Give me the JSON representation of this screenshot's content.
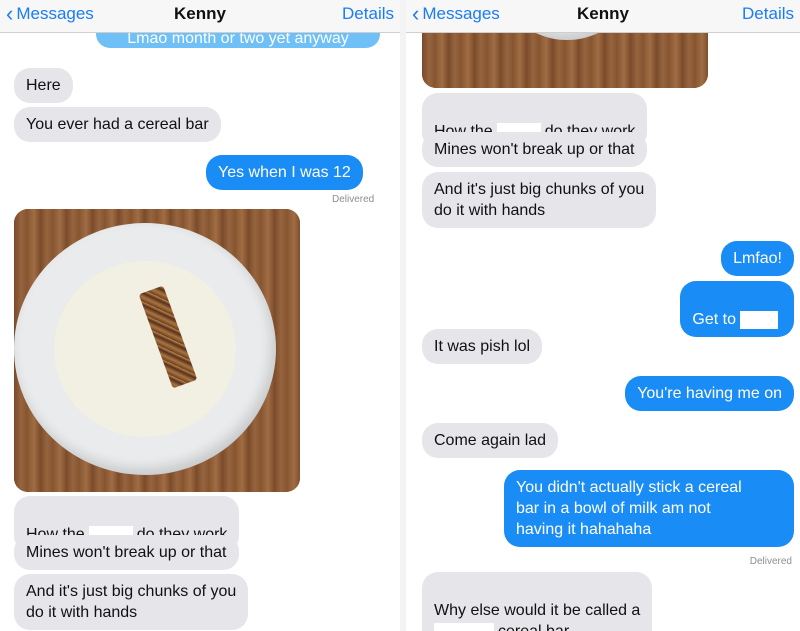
{
  "left_panel": {
    "nav": {
      "back_label": "Messages",
      "back_icon": "chevron-left-icon",
      "contact": "Kenny",
      "details_label": "Details"
    },
    "partial_top": "Lmao month or two yet anyway",
    "messages": {
      "m1": "Here",
      "m2": "You ever had a cereal bar",
      "m3": "Yes when I was 12",
      "delivered": "Delivered",
      "m4a": "How the",
      "m4b": "do they work",
      "m5": "Mines won't break up or that",
      "m6": "And it's just big chunks of you\ndo it with hands"
    }
  },
  "right_panel": {
    "nav": {
      "back_label": "Messages",
      "back_icon": "chevron-left-icon",
      "contact": "Kenny",
      "details_label": "Details"
    },
    "messages": {
      "m1a": "How the",
      "m1b": "do they work",
      "m2": "Mines won't break up or that",
      "m3": "And it's just big chunks of you\ndo it with hands",
      "m4": "Lmfao!",
      "m5": "Get to",
      "m6": "It was pish lol",
      "m7": "You're having me on",
      "m8": "Come again lad",
      "m9": "You didn't actually stick a cereal\nbar in a bowl of milk am not\nhaving it hahahaha",
      "delivered": "Delivered",
      "m10a": "Why else would it be called a",
      "m10b": "cereal bar"
    }
  },
  "colors": {
    "outgoing": "#1a8cf5",
    "incoming": "#e5e5ea",
    "link": "#1a7cf5"
  }
}
